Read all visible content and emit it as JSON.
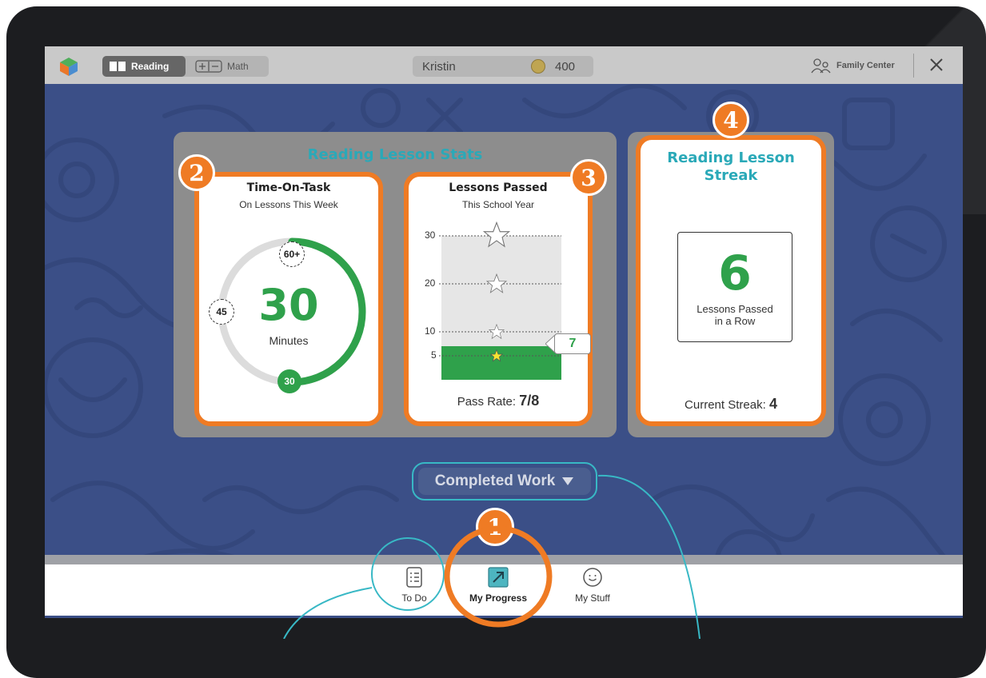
{
  "topbar": {
    "subjects": [
      {
        "label": "Reading",
        "icon": "book-icon",
        "selected": true
      },
      {
        "label": "Math",
        "icon": "plus-minus-icon",
        "selected": false
      }
    ],
    "user_name": "Kristin",
    "coins": "400",
    "family_center": "Family Center"
  },
  "stats_panel": {
    "title": "Reading Lesson Stats",
    "time_card": {
      "badge": "2",
      "title": "Time-On-Task",
      "subtitle": "On Lessons This Week",
      "value": "30",
      "unit": "Minutes",
      "goal_marker": "60+",
      "mid_marker": "45",
      "progress_marker": "30",
      "progress_minutes": 30,
      "goal_minutes": 60
    },
    "lessons_card": {
      "badge": "3",
      "title": "Lessons Passed",
      "subtitle": "This School Year",
      "ticks": [
        "30",
        "20",
        "10",
        "5"
      ],
      "passed_value": 7,
      "callout": "7",
      "pass_rate_label": "Pass Rate:",
      "pass_rate_value": "7/8"
    }
  },
  "streak_panel": {
    "badge": "4",
    "title_line1": "Reading Lesson",
    "title_line2": "Streak",
    "value": "6",
    "desc_line1": "Lessons Passed",
    "desc_line2": "in a Row",
    "current_label": "Current Streak:",
    "current_value": "4"
  },
  "completed_work": {
    "label": "Completed Work"
  },
  "bottom_nav": {
    "badge": "1",
    "items": [
      {
        "label": "To Do",
        "icon": "checklist-icon"
      },
      {
        "label": "My Progress",
        "icon": "progress-arrow-icon",
        "active": true
      },
      {
        "label": "My Stuff",
        "icon": "smiley-icon"
      }
    ]
  },
  "colors": {
    "orange": "#ef7b24",
    "teal": "#2aa9b8",
    "green": "#2fa14b",
    "screen_bg": "#3b4f87"
  }
}
